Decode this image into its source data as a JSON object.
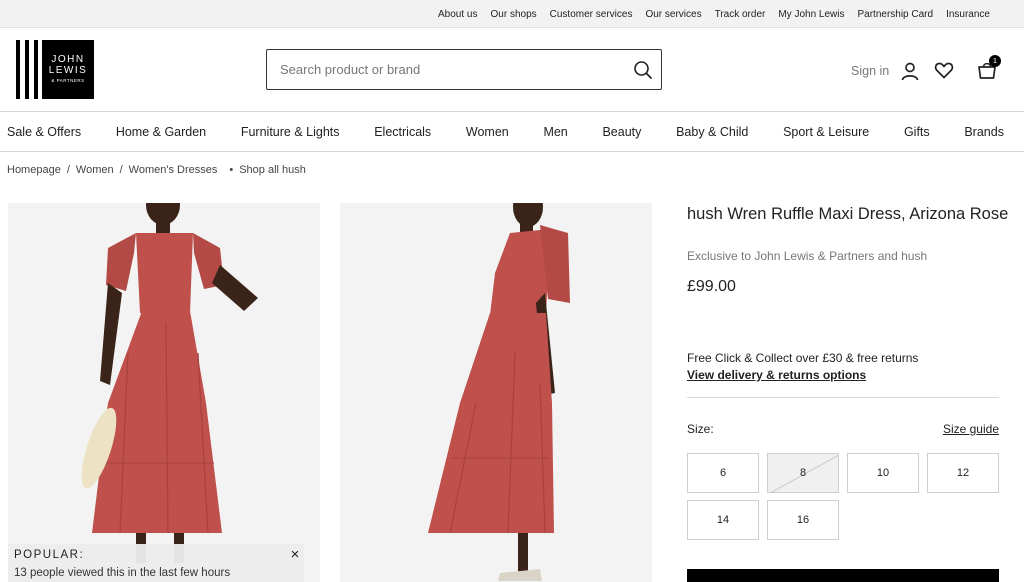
{
  "utility": {
    "links": [
      "About us",
      "Our shops",
      "Customer services",
      "Our services",
      "Track order",
      "My John Lewis",
      "Partnership Card",
      "Insurance"
    ]
  },
  "logo": {
    "line1": "JOHN",
    "line2": "LEWIS",
    "line3": "& PARTNERS"
  },
  "search": {
    "placeholder": "Search product or brand"
  },
  "account": {
    "signin": "Sign in",
    "basket_count": "1"
  },
  "nav": {
    "items": [
      "Sale & Offers",
      "Home & Garden",
      "Furniture & Lights",
      "Electricals",
      "Women",
      "Men",
      "Beauty",
      "Baby & Child",
      "Sport & Leisure",
      "Gifts",
      "Brands"
    ]
  },
  "breadcrumb": {
    "items": [
      "Homepage",
      "Women",
      "Women's Dresses"
    ],
    "separator": "/",
    "shop_all": "Shop all hush"
  },
  "product": {
    "title": "hush Wren Ruffle Maxi Dress, Arizona Rose",
    "exclusive": "Exclusive to John Lewis & Partners and hush",
    "price": "£99.00",
    "delivery_text": "Free Click & Collect over £30 & free returns",
    "delivery_link": "View delivery & returns options",
    "size_label": "Size:",
    "size_guide": "Size guide",
    "sizes": [
      "6",
      "8",
      "10",
      "12",
      "14",
      "16"
    ],
    "unavailable_size": "8"
  },
  "popular": {
    "title": "POPULAR:",
    "text": "13 people viewed this in the last few hours"
  },
  "colors": {
    "dress": "#c0504c",
    "accent": "#000000"
  }
}
